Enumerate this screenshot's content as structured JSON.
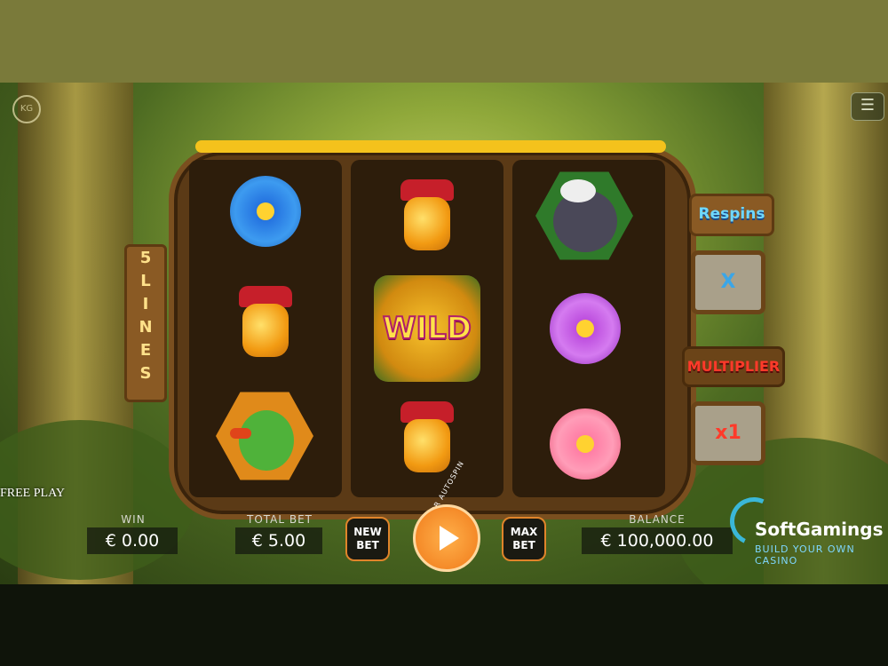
{
  "game": {
    "lines_sign": [
      "5",
      "L",
      "I",
      "N",
      "E",
      "S"
    ],
    "respins_label": "Respins",
    "respins_value": "X",
    "multiplier_label": "MULTIPLIER",
    "multiplier_value": "x1",
    "free_play": "FREE PLAY",
    "menu_icon": "hamburger-icon",
    "provider_logo": "KG"
  },
  "reels": [
    [
      "blue-flower",
      "honey-jar",
      "green-bird"
    ],
    [
      "honey-jar",
      "WILD",
      "honey-jar"
    ],
    [
      "badger",
      "purple-flower",
      "pink-flower"
    ]
  ],
  "wild_text": "WILD",
  "hud": {
    "win_label": "WIN",
    "win_value": "€ 0.00",
    "total_bet_label": "TOTAL BET",
    "total_bet_value": "€ 5.00",
    "new_bet_line1": "NEW",
    "new_bet_line2": "BET",
    "autospin_text": "HOLD FOR AUTOSPIN",
    "max_bet_line1": "MAX",
    "max_bet_line2": "BET",
    "balance_label": "BALANCE",
    "balance_value": "€ 100,000.00"
  },
  "watermark": {
    "brand": "SoftGamings",
    "tagline": "BUILD YOUR OWN CASINO"
  },
  "colors": {
    "accent": "#e0842a",
    "honey": "#f4c21c",
    "wood": "#5b3a16"
  }
}
